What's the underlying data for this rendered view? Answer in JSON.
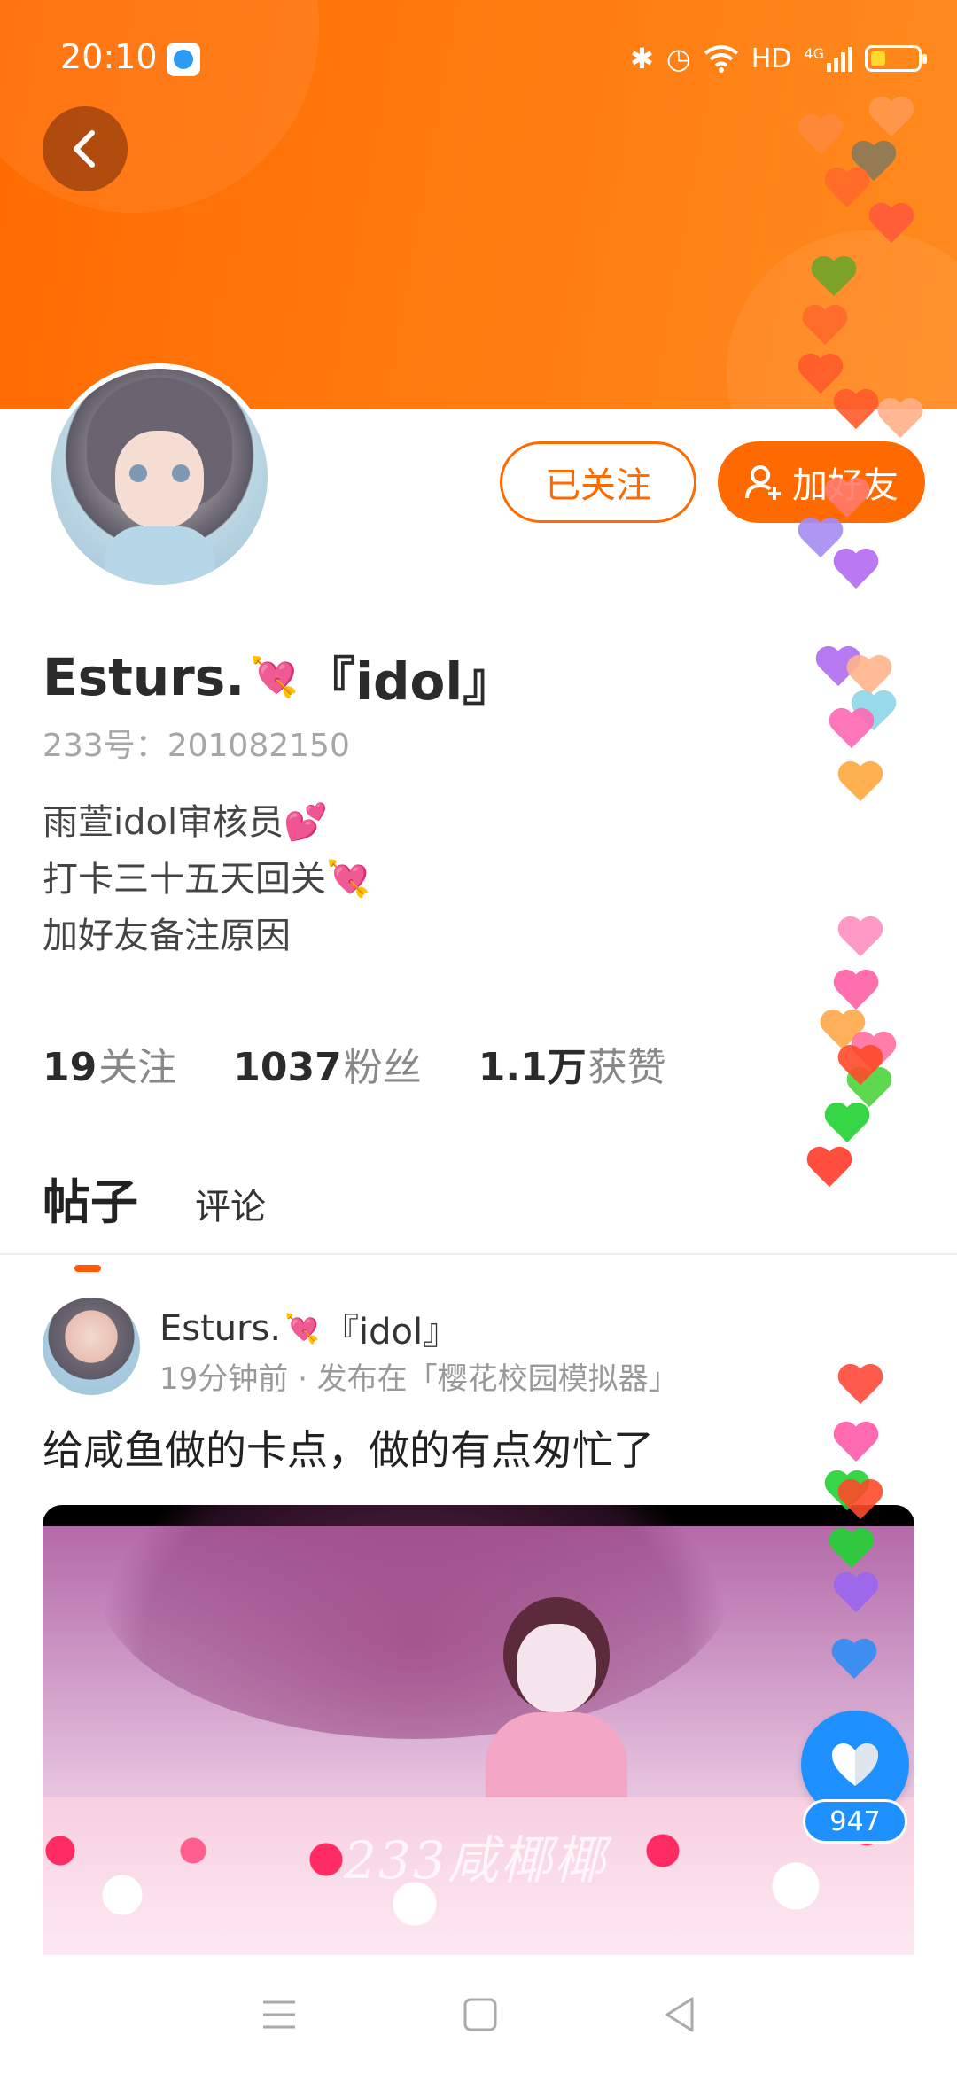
{
  "status_bar": {
    "time": "20:10",
    "network_label": "HD",
    "signal_label": "4G",
    "icons": [
      "bluetooth-icon",
      "alarm-icon",
      "wifi-icon",
      "signal-icon",
      "battery-icon"
    ]
  },
  "profile": {
    "name": "Esturs.",
    "name_suffix": "『idol』",
    "uid": "233号：201082150",
    "bio": [
      "雨萱idol审核员💕",
      "打卡三十五天回关💘",
      "加好友备注原因"
    ],
    "follow_label": "已关注",
    "add_friend_label": "加好友"
  },
  "stats": {
    "following_count": "19",
    "following_label": "关注",
    "fans_count": "1037",
    "fans_label": "粉丝",
    "likes_count": "1.1万",
    "likes_label": "获赞"
  },
  "tabs": [
    "帖子",
    "评论"
  ],
  "post": {
    "author": "Esturs.",
    "author_suffix": "『idol』",
    "meta": "19分钟前 · 发布在「樱花校园模拟器」",
    "text": "给咸鱼做的卡点，做的有点匆忙了",
    "watermark": "233咸椰椰"
  },
  "like": {
    "count": "947"
  },
  "colors": {
    "accent": "#ff6a00",
    "like_blue": "#1e90ff"
  }
}
